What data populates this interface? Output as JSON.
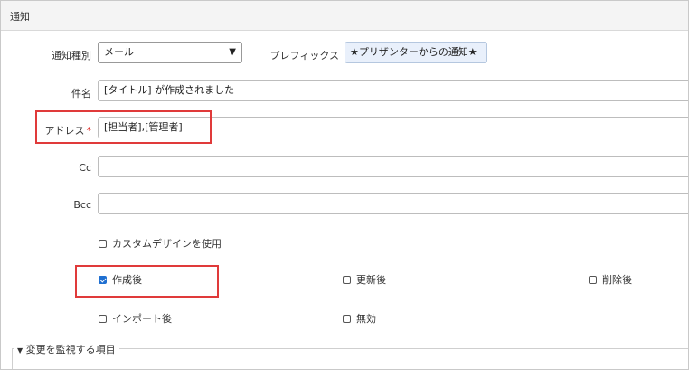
{
  "header": {
    "title": "通知"
  },
  "form": {
    "notify_type": {
      "label": "通知種別",
      "value": "メール"
    },
    "prefix": {
      "label": "プレフィックス",
      "value": "★プリザンターからの通知★"
    },
    "subject": {
      "label": "件名",
      "value": "[タイトル] が作成されました"
    },
    "address": {
      "label": "アドレス",
      "required_mark": "*",
      "value": "[担当者],[管理者]"
    },
    "cc": {
      "label": "Cc",
      "value": ""
    },
    "bcc": {
      "label": "Bcc",
      "value": ""
    }
  },
  "options": {
    "custom_design": {
      "label": "カスタムデザインを使用",
      "checked": false
    },
    "after_create": {
      "label": "作成後",
      "checked": true
    },
    "after_update": {
      "label": "更新後",
      "checked": false
    },
    "after_delete": {
      "label": "削除後",
      "checked": false
    },
    "after_import": {
      "label": "インポート後",
      "checked": false
    },
    "disabled": {
      "label": "無効",
      "checked": false
    }
  },
  "monitor_section": {
    "label": "変更を監視する項目",
    "expand_icon": "triangle-down"
  },
  "highlight_color": "#e03a3a"
}
